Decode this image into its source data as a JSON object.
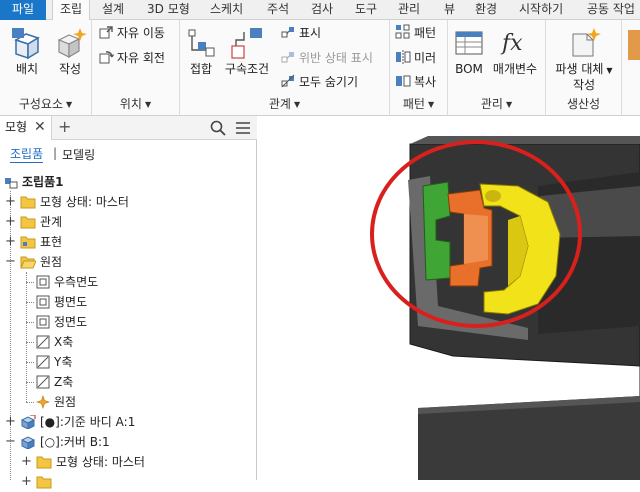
{
  "menu": {
    "tabs": [
      "파일",
      "조립",
      "설계",
      "3D 모형",
      "스케치",
      "주석",
      "검사",
      "도구",
      "관리",
      "뷰",
      "환경",
      "시작하기",
      "공동 작업"
    ]
  },
  "ribbon": {
    "groups": {
      "component": {
        "label": "구성요소",
        "place": "배치",
        "create": "작성"
      },
      "position": {
        "label": "위치",
        "free_move": "자유 이동",
        "free_rotate": "자유 회전"
      },
      "relationships": {
        "label": "관계",
        "joint": "접합",
        "constrain": "구속조건",
        "show": "표시",
        "show_sick": "위반 상태 표시",
        "hide_all": "모두 숨기기"
      },
      "pattern": {
        "label": "패턴",
        "pattern": "패턴",
        "mirror": "미러",
        "copy": "복사"
      },
      "manage": {
        "label": "관리",
        "bom": "BOM",
        "parameters": "매개변수"
      },
      "productivity": {
        "label": "생산성",
        "derived_line1": "파생 대체",
        "derived_line2": "작성"
      }
    }
  },
  "browser": {
    "tab_label": "모형",
    "close_glyph": "✕",
    "add_glyph": "+",
    "mode_active": "조립품",
    "mode_separator": "|",
    "mode_other": "모델링",
    "tree": [
      {
        "label": "조립품1"
      },
      {
        "label": "모형 상태: 마스터"
      },
      {
        "label": "관계"
      },
      {
        "label": "표현"
      },
      {
        "label": "원점"
      },
      {
        "label": "우측면도"
      },
      {
        "label": "평면도"
      },
      {
        "label": "정면도"
      },
      {
        "label": "X축"
      },
      {
        "label": "Y축"
      },
      {
        "label": "Z축"
      },
      {
        "label": "원점"
      },
      {
        "label": "[●]:기준 바디 A:1"
      },
      {
        "label": "[○]:커버 B:1"
      },
      {
        "label": "모형 상태: 마스터"
      }
    ]
  },
  "colors": {
    "accent": "#1976c8",
    "highlight_circle": "#d8201c",
    "part_green": "#3fa535",
    "part_orange": "#e8702a",
    "part_yellow": "#f2e21a",
    "housing": "#2e2e2e"
  }
}
